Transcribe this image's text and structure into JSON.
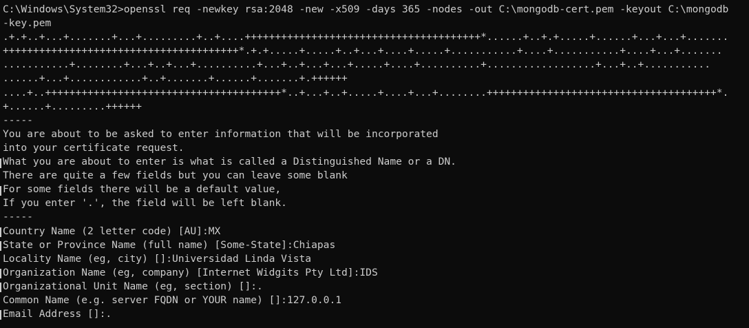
{
  "terminal": {
    "lines": [
      "C:\\Windows\\System32>openssl req -newkey rsa:2048 -new -x509 -days 365 -nodes -out C:\\mongodb-cert.pem -keyout C:\\mongodb",
      "-key.pem",
      ".+.+..+...+.......+...+.........+..+....+++++++++++++++++++++++++++++++++++++++*......+..+.+.....+......+...+...+.......",
      "+++++++++++++++++++++++++++++++++++++++*.+.+.....+.....+..+...+....+.....+...........+....+...........+....+...+.......",
      "...........+........+...+..+...+..........+...+..+...+...+.....+....+..........+..................+...+..+...........",
      "......+...+............+..+.......+......+.......+.++++++",
      "....+..+++++++++++++++++++++++++++++++++++++++*..+...+..+.....+....+...+........++++++++++++++++++++++++++++++++++++++*.",
      "+......+.........++++++",
      "-----",
      "You are about to be asked to enter information that will be incorporated",
      "into your certificate request.",
      "What you are about to enter is what is called a Distinguished Name or a DN.",
      "There are quite a few fields but you can leave some blank",
      "For some fields there will be a default value,",
      "If you enter '.', the field will be left blank.",
      "-----",
      "Country Name (2 letter code) [AU]:MX",
      "State or Province Name (full name) [Some-State]:Chiapas",
      "Locality Name (eg, city) []:Universidad Linda Vista",
      "Organization Name (eg, company) [Internet Widgits Pty Ltd]:IDS",
      "Organizational Unit Name (eg, section) []:.",
      "Common Name (e.g. server FQDN or YOUR name) []:127.0.0.1",
      "Email Address []:."
    ]
  }
}
